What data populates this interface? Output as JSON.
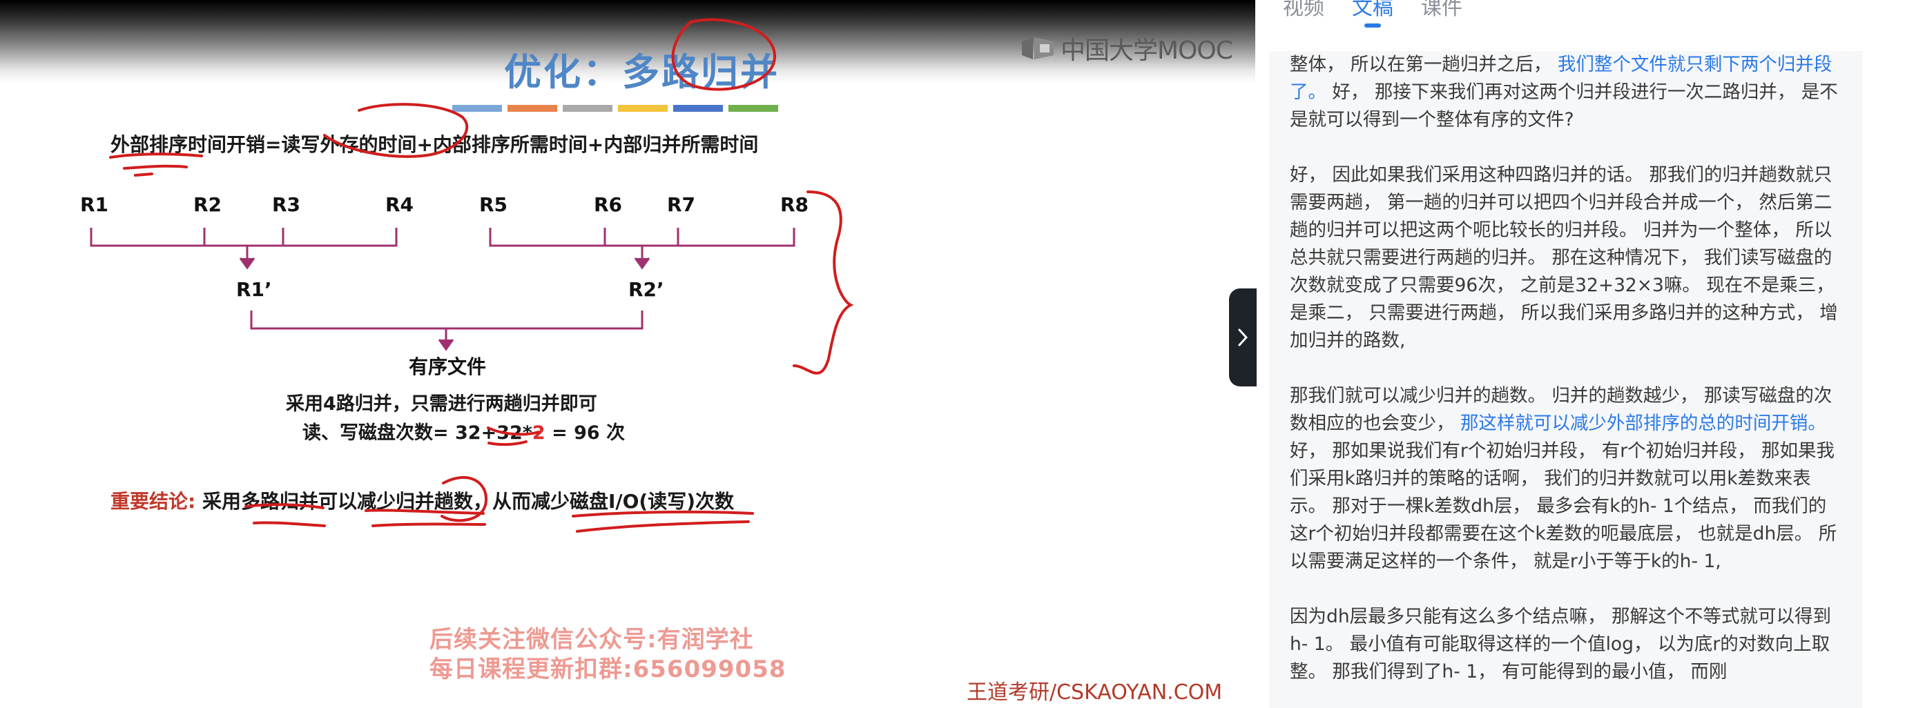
{
  "video": {
    "logo_text": "中国大学MOOC",
    "slide_title": "优化：多路归并",
    "color_bar": [
      "#7aa6d8",
      "#e8834b",
      "#a9a9a9",
      "#f2c33c",
      "#4a74c9",
      "#6fb04a"
    ],
    "formula": "外部排序时间开销=读写外存的时间+内部排序所需时间+内部归并所需时间",
    "runs": [
      "R1",
      "R2",
      "R3",
      "R4",
      "R5",
      "R6",
      "R7",
      "R8"
    ],
    "merged_runs": [
      "R1’",
      "R2’"
    ],
    "ordered_file": "有序文件",
    "note_line1": "采用4路归并，只需进行两趟归并即可",
    "note_line2_prefix": "读、写磁盘次数= 32+32*",
    "note_line2_red": "2",
    "note_line2_suffix": " = 96 次",
    "conclusion_label": "重要结论:",
    "conclusion_text": "采用多路归并可以减少归并趟数，从而减少磁盘I/O(读写)次数",
    "watermark_line1": "后续关注微信公众号:有润学社",
    "watermark_line2": "每日课程更新扣群:656099058",
    "credit": "王道考研/CSKAOYAN.COM"
  },
  "tabs": [
    {
      "label": "视频",
      "active": false
    },
    {
      "label": "文稿",
      "active": true
    },
    {
      "label": "课件",
      "active": false
    }
  ],
  "transcript": {
    "p1_a": "整体， 所以在第一趟归并之后， ",
    "p1_hl": "我们整个文件就只剩下两个归并段了。",
    "p1_b": " 好， 那接下来我们再对这两个归并段进行一次二路归并， 是不是就可以得到一个整体有序的文件?",
    "p2": "好， 因此如果我们采用这种四路归并的话。 那我们的归并趟数就只需要两趟， 第一趟的归并可以把四个归并段合并成一个， 然后第二趟的归并可以把这两个呃比较长的归并段。 归并为一个整体， 所以总共就只需要进行两趟的归并。 那在这种情况下， 我们读写磁盘的次数就变成了只需要96次， 之前是32+32×3嘛。 现在不是乘三， 是乘二， 只需要进行两趟， 所以我们采用多路归并的这种方式， 增加归并的路数,",
    "p3_a": "那我们就可以减少归并的趟数。 归并的趟数越少， 那读写磁盘的次数相应的也会变少， ",
    "p3_hl": "那这样就可以减少外部排序的总的时间开销。",
    "p3_b": " 好， 那如果说我们有r个初始归并段， 有r个初始归并段， 那如果我们采用k路归并的策略的话啊， 我们的归并数就可以用k差数来表示。 那对于一棵k差数dh层， 最多会有k的h- 1个结点， 而我们的这r个初始归并段都需要在这个k差数的呃最底层， 也就是dh层。 所以需要满足这样的一个条件， 就是r小于等于k的h- 1,",
    "p4": "因为dh层最多只能有这么多个结点嘛， 那解这个不等式就可以得到h- 1。 最小值有可能取得这样的一个值log， 以为底r的对数向上取整。 那我们得到了h- 1， 有可能得到的最小值， 而刚"
  },
  "icons": {
    "toggle": "chevron-right-icon",
    "logo": "mooc-logo-icon"
  }
}
